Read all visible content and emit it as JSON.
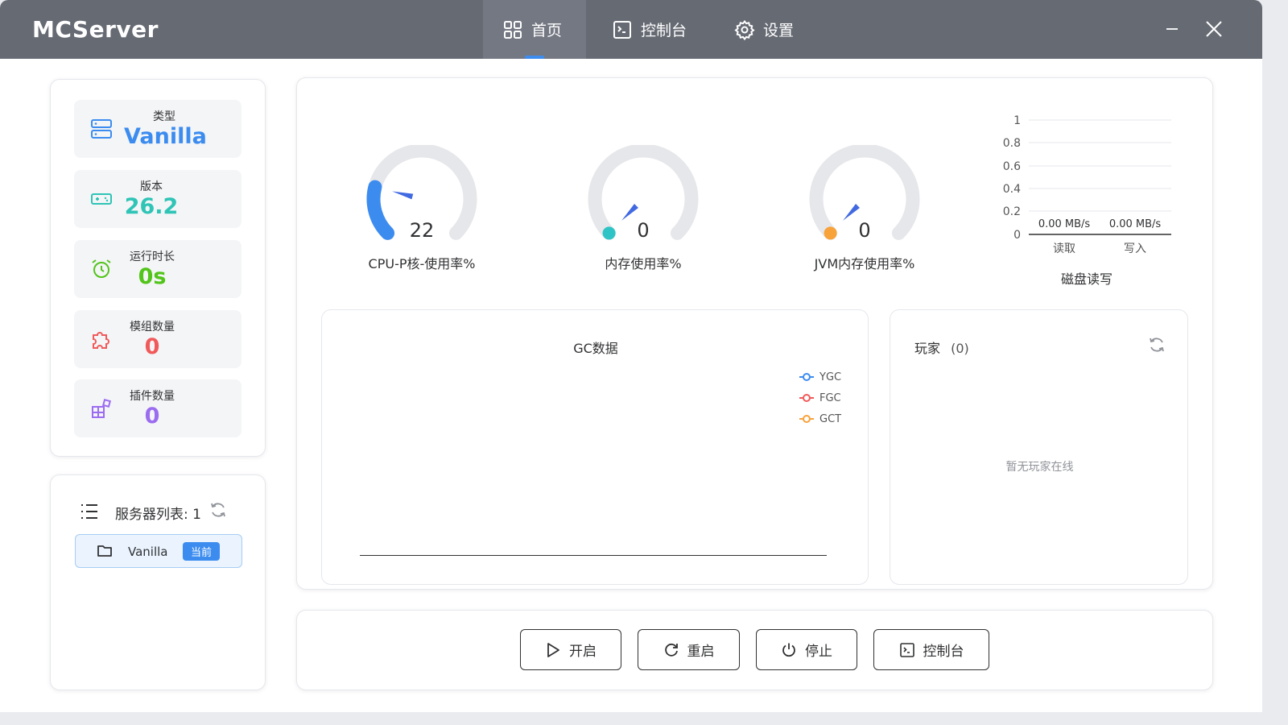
{
  "app": {
    "title": "MCServer"
  },
  "nav": [
    {
      "label": "首页",
      "icon": "dashboard-icon",
      "active": true
    },
    {
      "label": "控制台",
      "icon": "terminal-icon"
    },
    {
      "label": "设置",
      "icon": "gear-icon"
    }
  ],
  "stats": {
    "type": {
      "label": "类型",
      "value": "Vanilla",
      "color": "#3c8cf0"
    },
    "version": {
      "label": "版本",
      "value": "26.2",
      "color": "#2ec4b6"
    },
    "uptime": {
      "label": "运行时长",
      "value": "0s",
      "color": "#52c41a"
    },
    "mods": {
      "label": "模组数量",
      "value": "0",
      "color": "#f05a5a"
    },
    "plugins": {
      "label": "插件数量",
      "value": "0",
      "color": "#9b6cf0"
    }
  },
  "server_list": {
    "title": "服务器列表: 1",
    "items": [
      {
        "name": "Vanilla",
        "badge": "当前"
      }
    ]
  },
  "gauges": [
    {
      "label": "CPU-P核-使用率%",
      "value": 22,
      "color": "#3c8cf0"
    },
    {
      "label": "内存使用率%",
      "value": 0,
      "color": "#2ec4c6"
    },
    {
      "label": "JVM内存使用率%",
      "value": 0,
      "color": "#f8a23a"
    }
  ],
  "disk": {
    "title": "磁盘读写",
    "y_ticks": [
      "1",
      "0.8",
      "0.6",
      "0.4",
      "0.2",
      "0"
    ],
    "read_label": "读取",
    "write_label": "写入",
    "read_value": "0.00 MB/s",
    "write_value": "0.00 MB/s"
  },
  "gc": {
    "title": "GC数据",
    "legend": [
      {
        "name": "YGC",
        "color": "#3c8cf0"
      },
      {
        "name": "FGC",
        "color": "#f05a5a"
      },
      {
        "name": "GCT",
        "color": "#f8a23a"
      }
    ]
  },
  "players": {
    "title": "玩家",
    "count": "(0)",
    "empty_text": "暂无玩家在线"
  },
  "actions": {
    "start": "开启",
    "restart": "重启",
    "stop": "停止",
    "console": "控制台"
  },
  "colors": {
    "titlebar": "#666a73",
    "accent": "#3c8cf0"
  }
}
